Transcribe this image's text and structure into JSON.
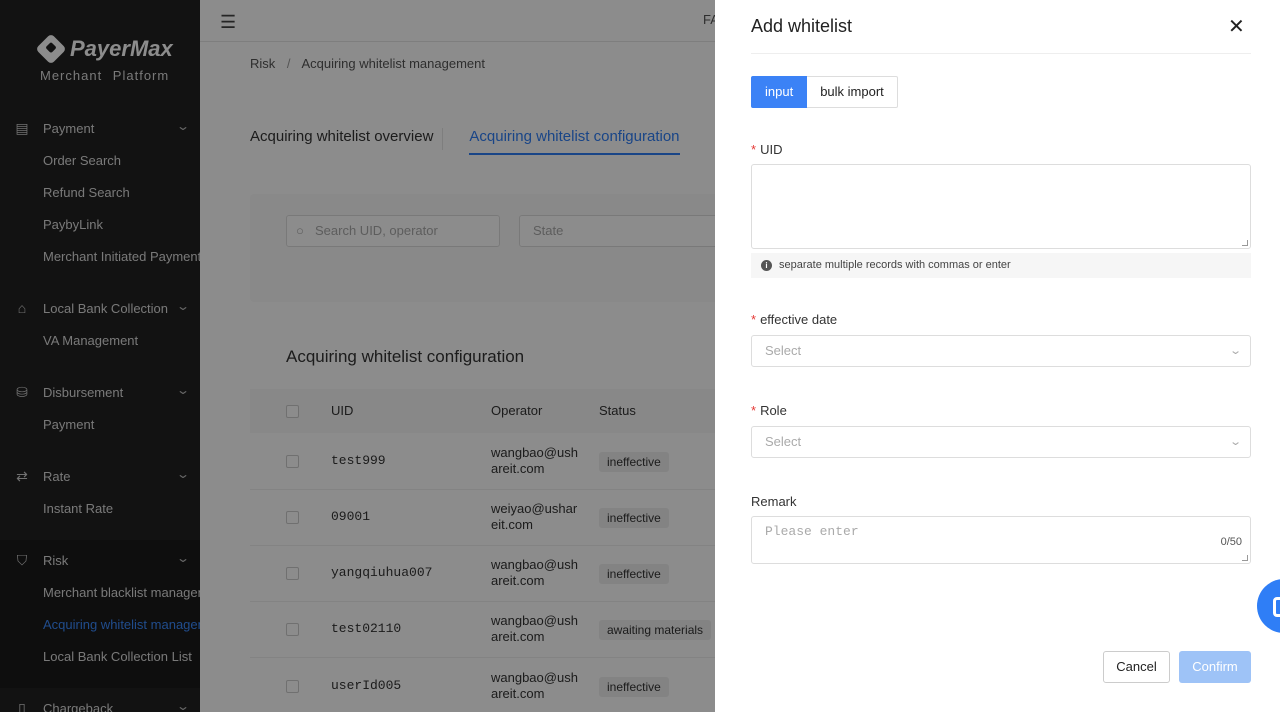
{
  "brand": {
    "name": "PayerMax",
    "subtitle": "Merchant Platform"
  },
  "sidebar": {
    "groups": [
      {
        "label": "Payment",
        "icon": "document-icon",
        "items": [
          "Order Search",
          "Refund Search",
          "PaybyLink",
          "Merchant Initiated Payments"
        ]
      },
      {
        "label": "Local Bank Collection",
        "icon": "bank-icon",
        "items": [
          "VA Management"
        ]
      },
      {
        "label": "Disbursement",
        "icon": "disbursement-icon",
        "items": [
          "Payment"
        ]
      },
      {
        "label": "Rate",
        "icon": "exchange-icon",
        "items": [
          "Instant Rate"
        ]
      },
      {
        "label": "Risk",
        "icon": "shield-icon",
        "items": [
          "Merchant blacklist management",
          "Acquiring whitelist management",
          "Local Bank Collection List"
        ]
      },
      {
        "label": "Chargeback",
        "icon": "chargeback-icon",
        "items": []
      }
    ],
    "active_item": "Acquiring whitelist management"
  },
  "topbar": {
    "text": "FA"
  },
  "breadcrumb": {
    "parent": "Risk",
    "sep": "/",
    "current": "Acquiring whitelist management"
  },
  "tabs": [
    {
      "label": "Acquiring whitelist overview",
      "active": false
    },
    {
      "label": "Acquiring whitelist configuration",
      "active": true
    }
  ],
  "filters": {
    "search_placeholder": "Search UID, operator",
    "state_placeholder": "State"
  },
  "table": {
    "title": "Acquiring whitelist configuration",
    "columns": [
      "UID",
      "Operator",
      "Status"
    ],
    "rows": [
      {
        "uid": "test999",
        "operator": [
          "wangbao@ush",
          "areit.com"
        ],
        "status": "ineffective"
      },
      {
        "uid": "09001",
        "operator": [
          "weiyao@ushar",
          "eit.com"
        ],
        "status": "ineffective"
      },
      {
        "uid": "yangqiuhua007",
        "operator": [
          "wangbao@ush",
          "areit.com"
        ],
        "status": "ineffective"
      },
      {
        "uid": "test02110",
        "operator": [
          "wangbao@ush",
          "areit.com"
        ],
        "status": "awaiting materials"
      },
      {
        "uid": "userId005",
        "operator": [
          "wangbao@ush",
          "areit.com"
        ],
        "status": "ineffective"
      }
    ]
  },
  "drawer": {
    "title": "Add whitelist",
    "modes": {
      "input": "input",
      "bulk": "bulk import"
    },
    "uid_label": "UID",
    "uid_hint": "separate multiple records with commas or enter",
    "date_label": "effective date",
    "date_placeholder": "Select",
    "role_label": "Role",
    "role_placeholder": "Select",
    "remark_label": "Remark",
    "remark_placeholder": "Please enter",
    "remark_count": "0/50",
    "cancel": "Cancel",
    "confirm": "Confirm"
  },
  "colors": {
    "primary": "#3b82f6",
    "sidebar_bg": "#222222",
    "required": "#e53935"
  }
}
